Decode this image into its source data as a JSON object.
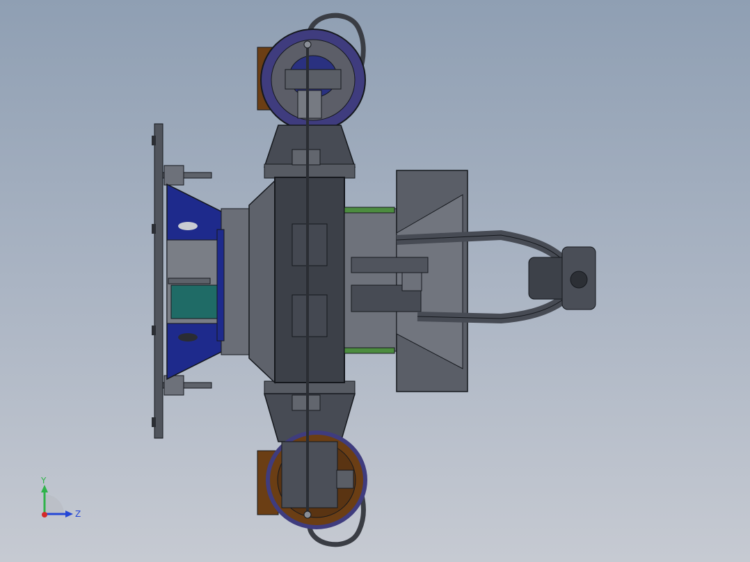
{
  "window": {
    "content": "solidworks-3d-assembly-view"
  },
  "model": {
    "colors": {
      "steel_dark": "#4a4e57",
      "steel_mid": "#6b7079",
      "steel_light": "#8d929a",
      "blue_part": "#1e2a8c",
      "blue_dark": "#151d63",
      "teal_part": "#1f6b66",
      "brown_part": "#6b3e14",
      "green_trim": "#4c8c3f",
      "edge": "#15181d"
    }
  },
  "triad": {
    "y_label": "Y",
    "z_label": "Z",
    "y_color": "#2fb34a",
    "z_color": "#2446d6",
    "x_color": "#d42a2a"
  }
}
